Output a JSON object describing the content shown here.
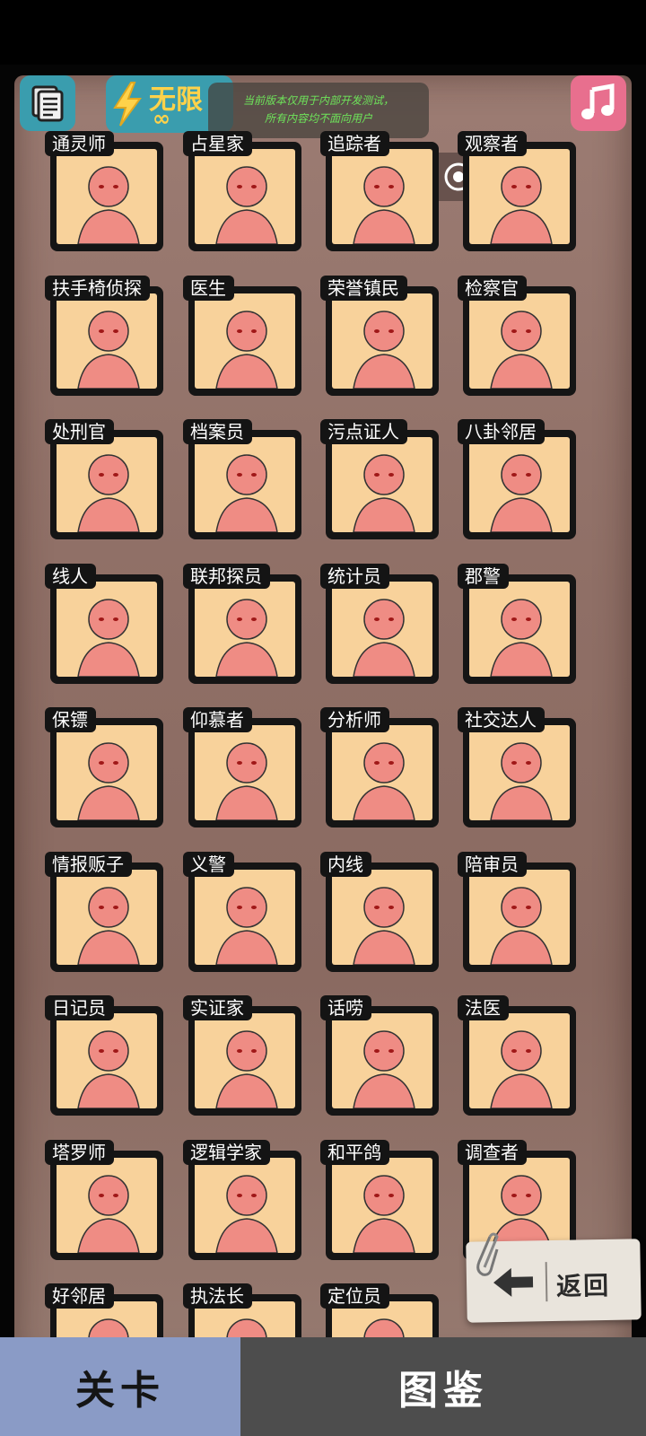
{
  "header": {
    "energy_label": "无限",
    "energy_value": "∞",
    "notice_line1": "当前版本仅用于内部开发测试，",
    "notice_line2": "所有内容均不面向用户"
  },
  "icons": {
    "menu": "document-icon",
    "music": "music-note-icon",
    "energy": "lightning-icon",
    "capsule_more": "more-dots-icon",
    "capsule_close": "target-circle-icon"
  },
  "cards": [
    {
      "label": "通灵师"
    },
    {
      "label": "占星家"
    },
    {
      "label": "追踪者"
    },
    {
      "label": "观察者"
    },
    {
      "label": "扶手椅侦探"
    },
    {
      "label": "医生"
    },
    {
      "label": "荣誉镇民"
    },
    {
      "label": "检察官"
    },
    {
      "label": "处刑官"
    },
    {
      "label": "档案员"
    },
    {
      "label": "污点证人"
    },
    {
      "label": "八卦邻居"
    },
    {
      "label": "线人"
    },
    {
      "label": "联邦探员"
    },
    {
      "label": "统计员"
    },
    {
      "label": "郡警"
    },
    {
      "label": "保镖"
    },
    {
      "label": "仰慕者"
    },
    {
      "label": "分析师"
    },
    {
      "label": "社交达人"
    },
    {
      "label": "情报贩子"
    },
    {
      "label": "义警"
    },
    {
      "label": "内线"
    },
    {
      "label": "陪审员"
    },
    {
      "label": "日记员"
    },
    {
      "label": "实证家"
    },
    {
      "label": "话唠"
    },
    {
      "label": "法医"
    },
    {
      "label": "塔罗师"
    },
    {
      "label": "逻辑学家"
    },
    {
      "label": "和平鸽"
    },
    {
      "label": "调查者"
    },
    {
      "label": "好邻居"
    },
    {
      "label": "执法长"
    },
    {
      "label": "定位员"
    }
  ],
  "back_button": {
    "label": "返回"
  },
  "tabs": {
    "levels": "关卡",
    "gallery": "图鉴"
  },
  "colors": {
    "card_bg": "#f8d29b",
    "accent_teal": "#3a9dae",
    "energy_yellow": "#ffd24a",
    "tab_active": "#8a9bc6"
  }
}
